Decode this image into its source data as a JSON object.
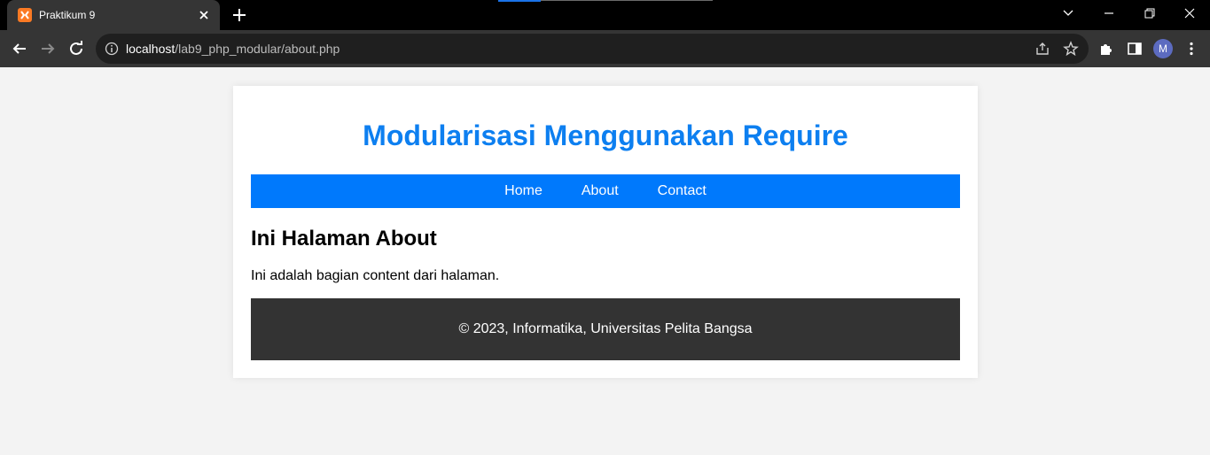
{
  "browser": {
    "tab_title": "Praktikum 9",
    "url_host": "localhost",
    "url_path": "/lab9_php_modular/about.php",
    "profile_initial": "M"
  },
  "page": {
    "site_title": "Modularisasi Menggunakan Require",
    "nav": [
      {
        "label": "Home"
      },
      {
        "label": "About"
      },
      {
        "label": "Contact"
      }
    ],
    "heading": "Ini Halaman About",
    "body_text": "Ini adalah bagian content dari halaman.",
    "footer_text": "© 2023, Informatika, Universitas Pelita Bangsa"
  },
  "colors": {
    "title": "#0d7ff0",
    "nav_bg": "#0079fc",
    "footer_bg": "#333333",
    "page_bg": "#f3f3f3"
  }
}
